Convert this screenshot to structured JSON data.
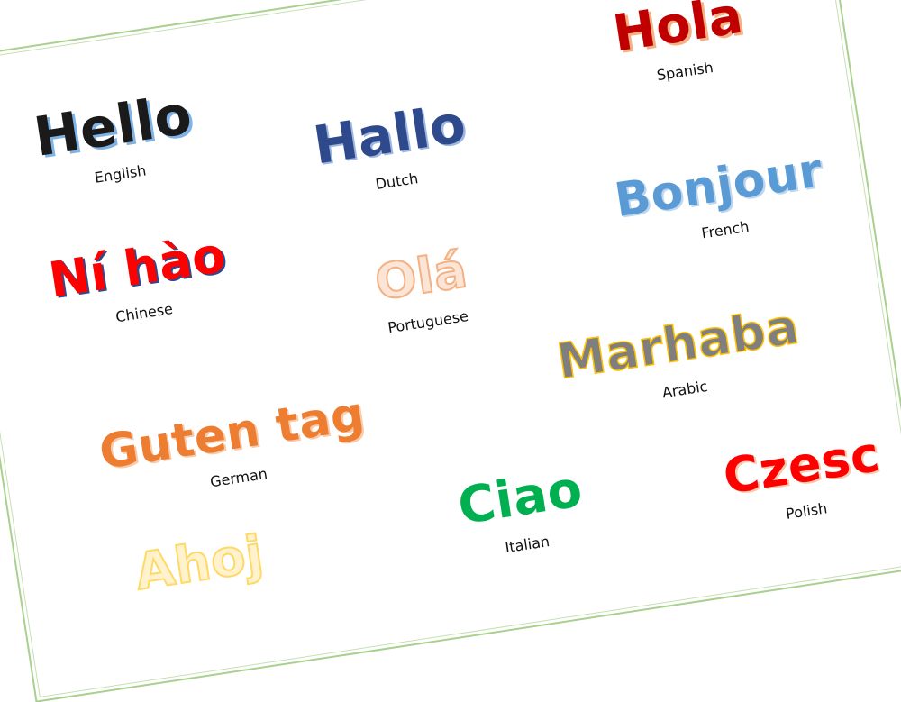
{
  "greetings": [
    {
      "word": "Hello",
      "lang": "English",
      "color": "#1a1a1a",
      "shadow": "#7fb2e5"
    },
    {
      "word": "Hallo",
      "lang": "Dutch",
      "color": "#2e4a8c",
      "shadow": "#9db7e0"
    },
    {
      "word": "Hola",
      "lang": "Spanish",
      "color": "#c00000",
      "shadow": "#f4b183"
    },
    {
      "word": "Bonjour",
      "lang": "French",
      "color": "#5b9bd5",
      "shadow": "#1f4e79"
    },
    {
      "word": "Ní hào",
      "lang": "Chinese",
      "color": "#ff0000",
      "shadow": "#2e4a8c"
    },
    {
      "word": "Olá",
      "lang": "Portuguese",
      "color": "#fbe5d6",
      "shadow": "#f4b183"
    },
    {
      "word": "Marhaba",
      "lang": "Arabic",
      "color": "#7f7f7f",
      "shadow": "#ffc000"
    },
    {
      "word": "Guten tag",
      "lang": "German",
      "color": "#ed7d31",
      "shadow": "#f8cbad"
    },
    {
      "word": "Ciao",
      "lang": "Italian",
      "color": "#00b050",
      "shadow": "#a9d18e"
    },
    {
      "word": "Czesc",
      "lang": "Polish",
      "color": "#ff0000",
      "shadow": "#f4b183"
    },
    {
      "word": "Ahoj",
      "lang": "",
      "color": "#fff2cc",
      "shadow": "#ffd966"
    }
  ]
}
